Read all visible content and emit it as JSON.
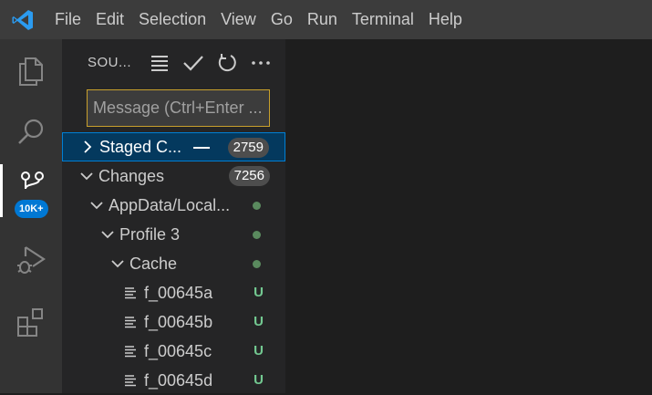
{
  "menu": [
    "File",
    "Edit",
    "Selection",
    "View",
    "Go",
    "Run",
    "Terminal",
    "Help"
  ],
  "activity_bar": {
    "source_control_badge": "10K+"
  },
  "scm": {
    "title": "SOU...",
    "message_placeholder": "Message (Ctrl+Enter ...",
    "staged": {
      "label": "Staged C...",
      "count": "2759"
    },
    "changes": {
      "label": "Changes",
      "count": "7256"
    },
    "tree": [
      {
        "label": "AppData/Local...",
        "status": "dot"
      },
      {
        "label": "Profile 3",
        "status": "dot"
      },
      {
        "label": "Cache",
        "status": "dot"
      }
    ],
    "files": [
      {
        "name": "f_00645a",
        "status": "U"
      },
      {
        "name": "f_00645b",
        "status": "U"
      },
      {
        "name": "f_00645c",
        "status": "U"
      },
      {
        "name": "f_00645d",
        "status": "U"
      }
    ]
  },
  "colors": {
    "accent": "#007fd4",
    "badge": "#0078d4",
    "untracked": "#73c991",
    "input_border": "#c8a02c"
  }
}
